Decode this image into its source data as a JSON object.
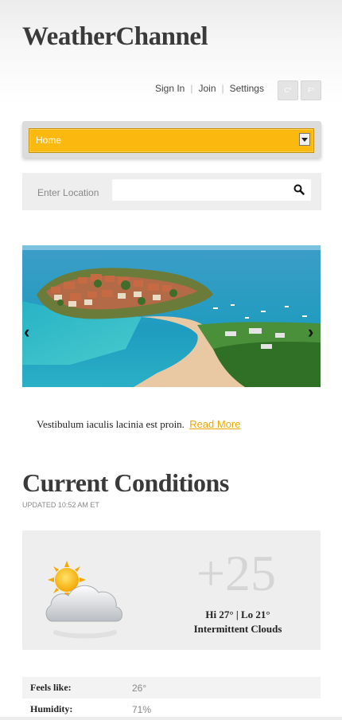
{
  "site": {
    "title": "WeatherChannel"
  },
  "topnav": {
    "sign_in": "Sign In",
    "join": "Join",
    "settings": "Settings"
  },
  "units": {
    "celsius": "C°",
    "fahrenheit": "F°"
  },
  "menu": {
    "selected": "Home"
  },
  "search": {
    "label": "Enter Location",
    "placeholder": "",
    "value": ""
  },
  "slider": {
    "image": "coastal-island-photo",
    "prev": "‹",
    "next": "›"
  },
  "caption": {
    "text": "Vestibulum iaculis lacinia est proin.",
    "link": "Read More"
  },
  "conditions": {
    "title": "Current Conditions",
    "updated": "UPDATED 10:52 AM ET",
    "icon": "partly-cloudy-icon",
    "temp": "+25",
    "hilo": "Hi 27° | Lo 21°",
    "description": "Intermittent Clouds"
  },
  "stats": [
    {
      "label": "Feels like:",
      "value": "26°"
    },
    {
      "label": "Humidity:",
      "value": "71%"
    }
  ],
  "colors": {
    "accent": "#fbb80f",
    "link": "#e8a800"
  }
}
